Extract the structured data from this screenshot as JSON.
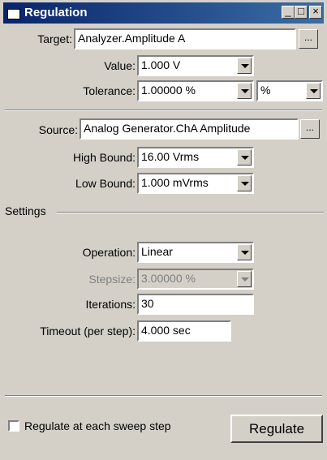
{
  "window": {
    "title": "Regulation",
    "controls": [
      "minimize-icon",
      "maximize-icon",
      "close-icon"
    ]
  },
  "target": {
    "label": "Target:",
    "value": "Analyzer.Amplitude A",
    "browse": "..."
  },
  "value": {
    "label": "Value:",
    "value": "1.000   V"
  },
  "tolerance": {
    "label": "Tolerance:",
    "value": "1.00000  %",
    "unit": "%"
  },
  "source": {
    "label": "Source:",
    "value": "Analog Generator.ChA Amplitude",
    "browse": "..."
  },
  "high_bound": {
    "label": "High Bound:",
    "value": "16.00    Vrms"
  },
  "low_bound": {
    "label": "Low Bound:",
    "value": "1.000    mVrms"
  },
  "settings": {
    "group_label": "Settings",
    "operation": {
      "label": "Operation:",
      "value": "Linear"
    },
    "stepsize": {
      "label": "Stepsize:",
      "value": "3.00000  %"
    },
    "iterations": {
      "label": "Iterations:",
      "value": "30"
    },
    "timeout": {
      "label": "Timeout (per step):",
      "value": "4.000    sec"
    }
  },
  "footer": {
    "checkbox_label": "Regulate at each sweep step",
    "regulate_button": "Regulate"
  }
}
